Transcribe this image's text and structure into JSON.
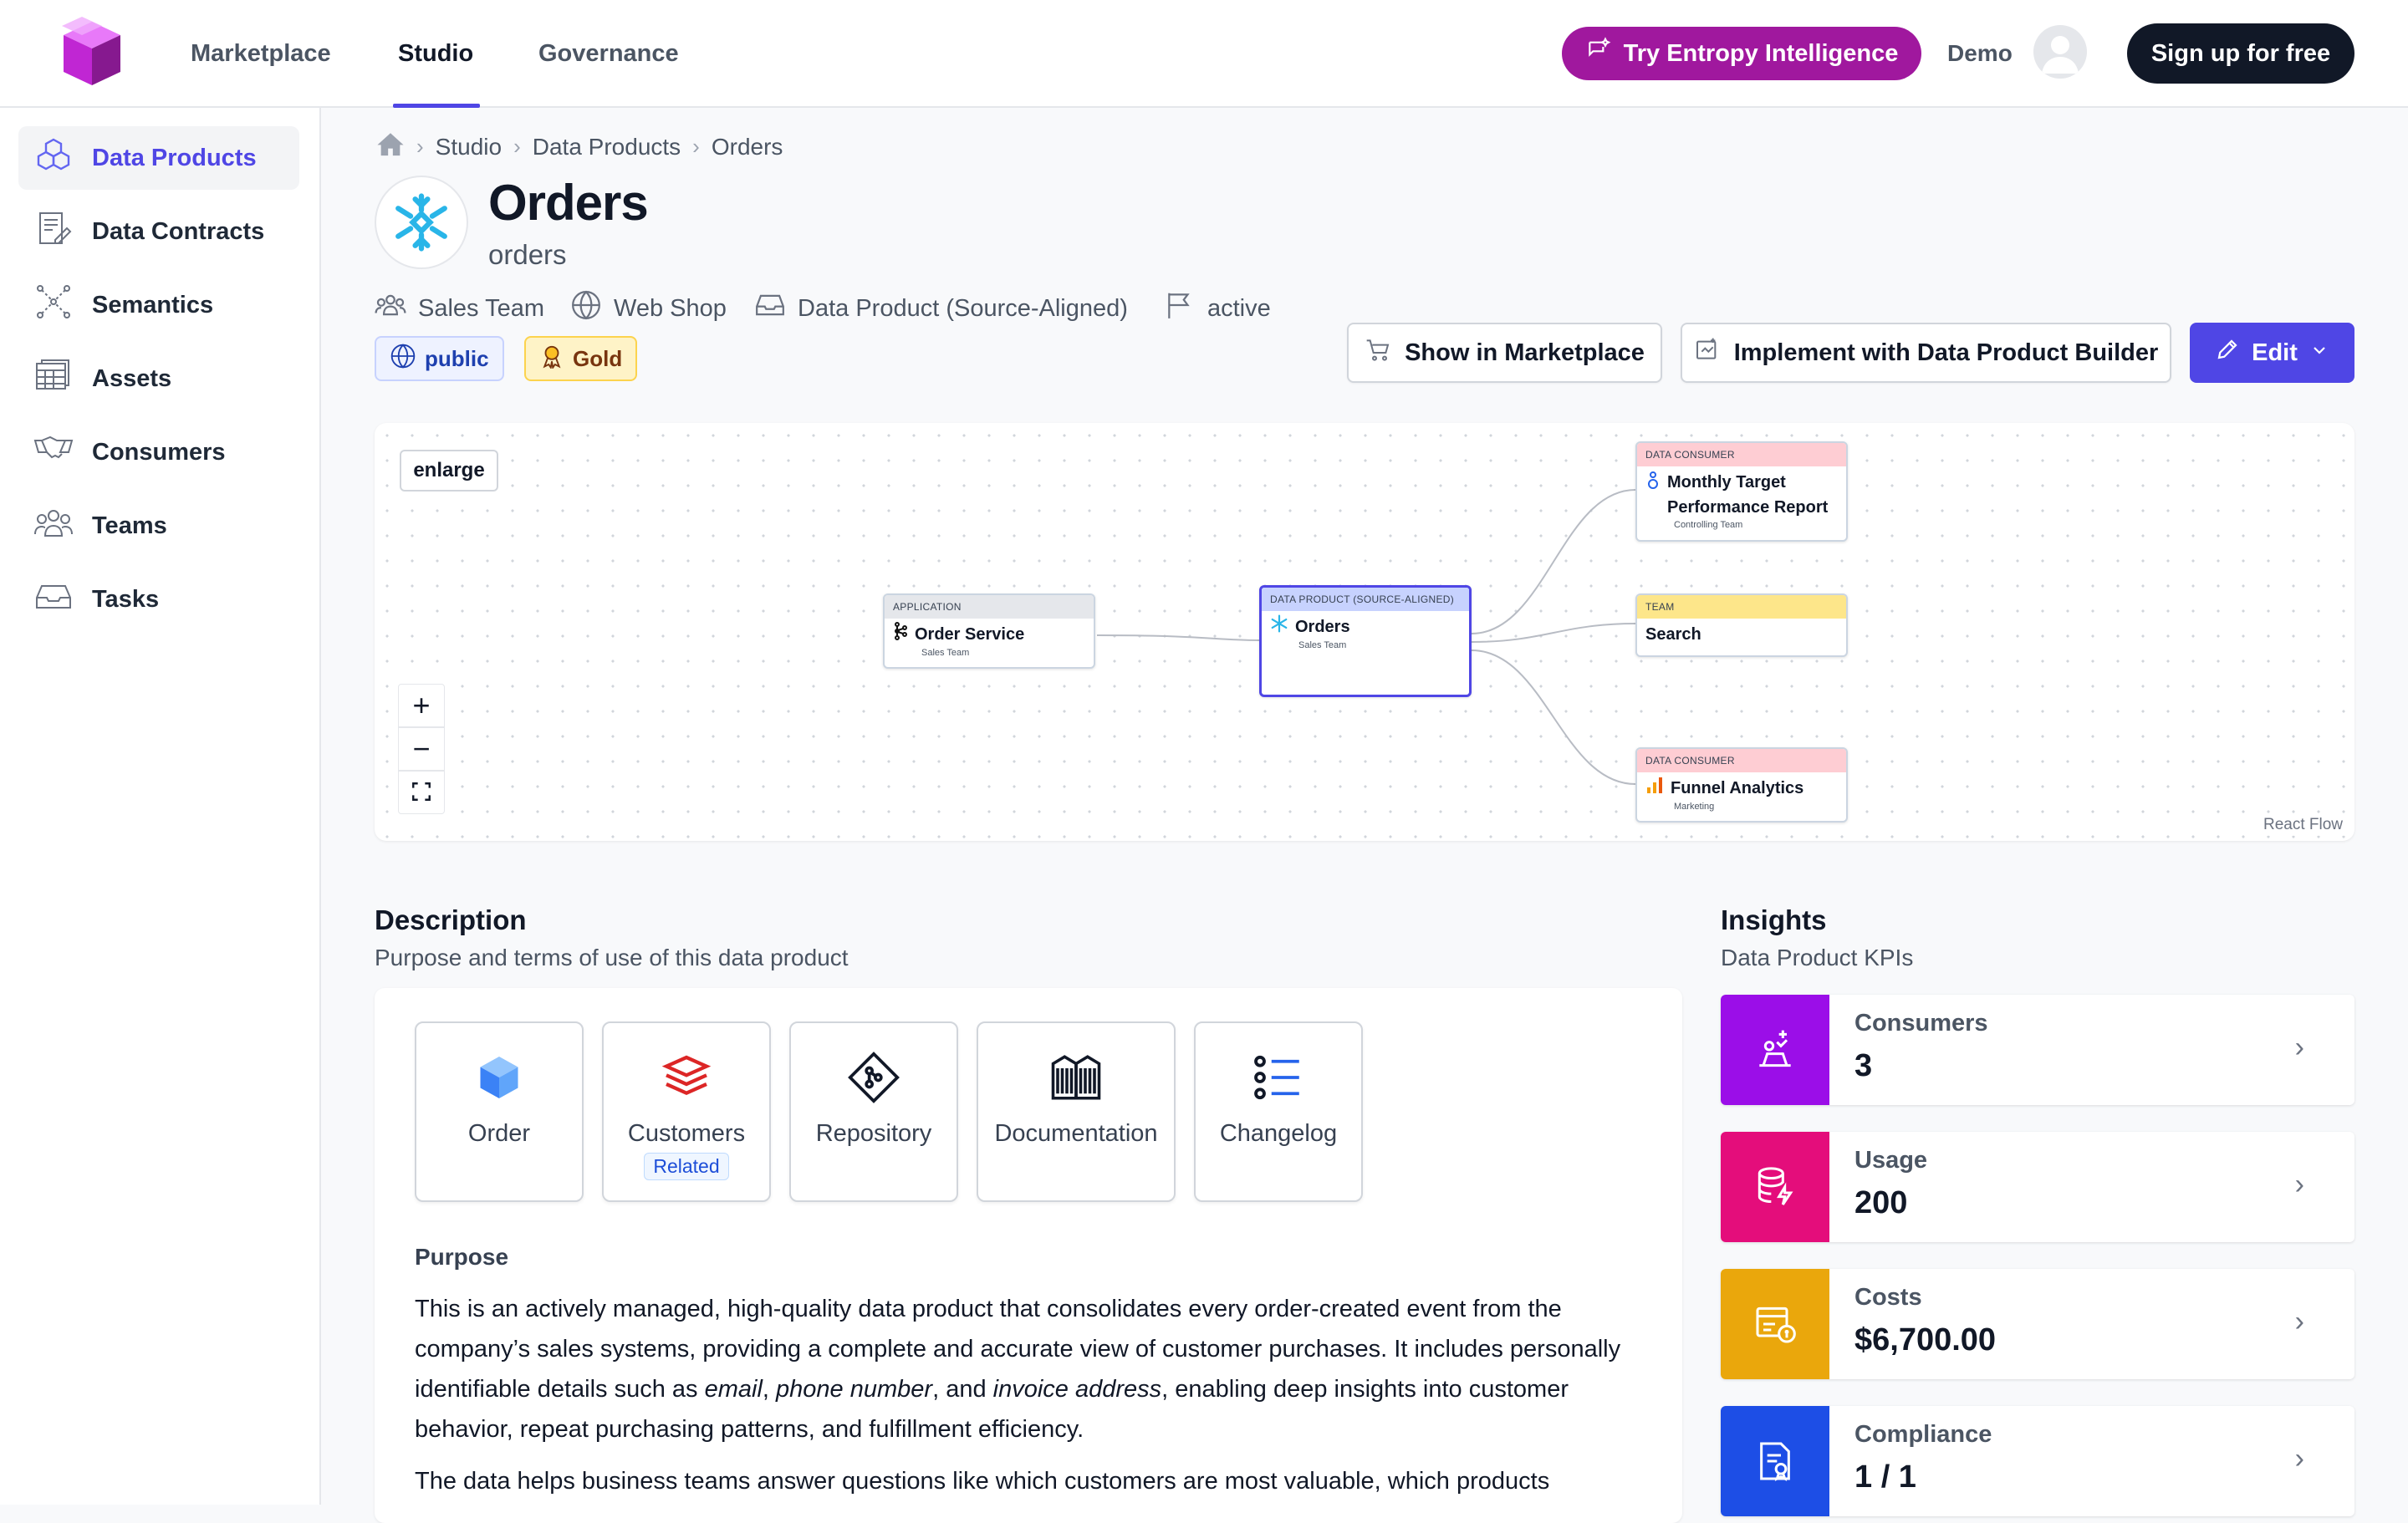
{
  "header": {
    "nav": [
      "Marketplace",
      "Studio",
      "Governance"
    ],
    "active_nav": "Studio",
    "intelligence_label": "Try Entropy Intelligence",
    "user_label": "Demo",
    "signup_label": "Sign up for free",
    "brand_color": "#a0189e"
  },
  "sidebar": {
    "items": [
      {
        "label": "Data Products",
        "icon": "cubes-icon",
        "active": true
      },
      {
        "label": "Data Contracts",
        "icon": "contract-icon",
        "active": false
      },
      {
        "label": "Semantics",
        "icon": "graph-icon",
        "active": false
      },
      {
        "label": "Assets",
        "icon": "table-icon",
        "active": false
      },
      {
        "label": "Consumers",
        "icon": "handshake-icon",
        "active": false
      },
      {
        "label": "Teams",
        "icon": "users-icon",
        "active": false
      },
      {
        "label": "Tasks",
        "icon": "inbox-icon",
        "active": false
      }
    ]
  },
  "breadcrumb": [
    "Studio",
    "Data Products",
    "Orders"
  ],
  "product": {
    "title": "Orders",
    "subtitle": "orders",
    "meta": {
      "team": "Sales Team",
      "domain": "Web Shop",
      "type": "Data Product (Source-Aligned)",
      "status": "active"
    },
    "tags": {
      "visibility": "public",
      "tier": "Gold"
    }
  },
  "actions": {
    "marketplace": "Show in Marketplace",
    "builder": "Implement with Data Product Builder",
    "edit": "Edit"
  },
  "flow": {
    "enlarge_label": "enlarge",
    "zoom_in": "+",
    "zoom_out": "−",
    "attribution": "React Flow",
    "nodes": {
      "order_service": {
        "type": "APPLICATION",
        "title": "Order Service",
        "sub": "Sales Team"
      },
      "orders": {
        "type": "DATA PRODUCT (SOURCE-ALIGNED)",
        "title": "Orders",
        "sub": "Sales Team"
      },
      "monthly": {
        "type": "DATA CONSUMER",
        "title": "Monthly Target Performance Report",
        "sub": "Controlling Team"
      },
      "search": {
        "type": "TEAM",
        "title": "Search",
        "sub": ""
      },
      "funnel": {
        "type": "DATA CONSUMER",
        "title": "Funnel Analytics",
        "sub": "Marketing"
      }
    }
  },
  "description": {
    "heading": "Description",
    "subheading": "Purpose and terms of use of this data product",
    "tiles": [
      {
        "label": "Order",
        "icon": "cube-icon"
      },
      {
        "label": "Customers",
        "icon": "layers-icon",
        "badge": "Related"
      },
      {
        "label": "Repository",
        "icon": "git-icon"
      },
      {
        "label": "Documentation",
        "icon": "books-icon"
      },
      {
        "label": "Changelog",
        "icon": "list-icon"
      }
    ],
    "purpose_heading": "Purpose",
    "purpose": {
      "p1_a": "This is an actively managed, high-quality data product that consolidates every order-created event from the company’s sales systems, providing a complete and accurate view of customer purchases. It includes personally identifiable details such as ",
      "p1_email": "email",
      "p1_sep1": ", ",
      "p1_phone": "phone number",
      "p1_sep2": ", and ",
      "p1_invoice": "invoice address",
      "p1_b": ", enabling deep insights into customer behavior, repeat purchasing patterns, and fulfillment efficiency.",
      "p2": "The data helps business teams answer questions like which customers are most valuable, which products"
    }
  },
  "insights": {
    "heading": "Insights",
    "subheading": "Data Product KPIs",
    "kpis": [
      {
        "label": "Consumers",
        "value": "3",
        "color": "#9b0ee8",
        "icon": "consumers-icon"
      },
      {
        "label": "Usage",
        "value": "200",
        "color": "#e40d7b",
        "icon": "database-icon"
      },
      {
        "label": "Costs",
        "value": "$6,700.00",
        "color": "#eaa70c",
        "icon": "costs-icon"
      },
      {
        "label": "Compliance",
        "value": "1 / 1",
        "color": "#1d4ee6",
        "icon": "compliance-icon"
      }
    ]
  }
}
